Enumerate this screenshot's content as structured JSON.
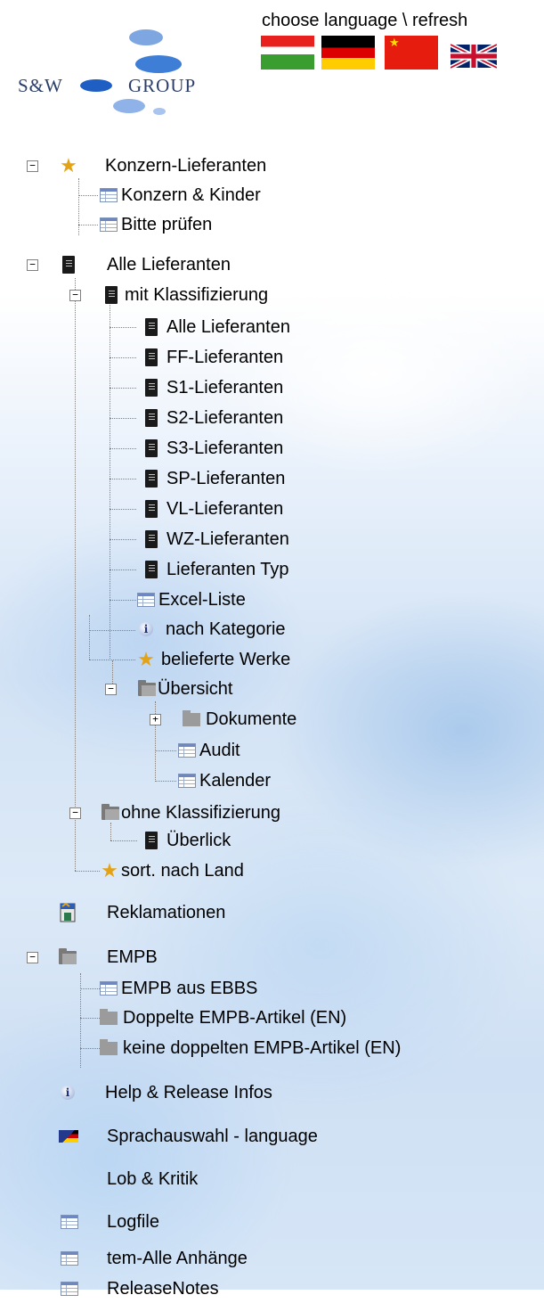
{
  "header": {
    "language_link": "choose language \\ refresh",
    "logo_left": "S&W",
    "logo_right": "GROUP",
    "flags": [
      "hungarian-flag-icon",
      "german-flag-icon",
      "chinese-flag-icon",
      "uk-flag-icon"
    ]
  },
  "tree": {
    "konzern": {
      "label": "Konzern-Lieferanten",
      "toggle": "−",
      "children": [
        "Konzern & Kinder",
        "Bitte prüfen"
      ]
    },
    "alle": {
      "label": "Alle Lieferanten",
      "toggle": "−",
      "mit_klass": {
        "label": "mit Klassifizierung",
        "toggle": "−",
        "items": [
          "Alle Lieferanten",
          "FF-Lieferanten",
          "S1-Lieferanten",
          "S2-Lieferanten",
          "S3-Lieferanten",
          "SP-Lieferanten",
          "VL-Lieferanten",
          "WZ-Lieferanten",
          "Lieferanten Typ"
        ],
        "excel": "Excel-Liste"
      },
      "nach_kategorie": "nach Kategorie",
      "belieferte_werke": "belieferte Werke",
      "uebersicht": {
        "label": "Übersicht",
        "toggle": "−",
        "dokumente": "Dokumente",
        "dokumente_toggle": "+",
        "audit": "Audit",
        "kalender": "Kalender"
      },
      "ohne_klass": {
        "label": "ohne Klassifizierung",
        "toggle": "−",
        "ueberlick": "Überlick"
      },
      "sort_land": "sort. nach Land"
    },
    "reklamationen": "Reklamationen",
    "empb": {
      "label": "EMPB",
      "toggle": "−",
      "children": [
        "EMPB aus EBBS",
        "Doppelte EMPB-Artikel (EN)",
        "keine doppelten EMPB-Artikel (EN)"
      ]
    },
    "help": "Help & Release Infos",
    "sprachauswahl": "Sprachauswahl - language",
    "lob": "Lob & Kritik",
    "logfile": "Logfile",
    "anhaenge": "tem-Alle Anhänge",
    "releasenotes": "ReleaseNotes"
  },
  "colors": {
    "star": "#e4a317",
    "logo_blue": "#2f6fc9",
    "logo_text": "#2b3e6a"
  }
}
